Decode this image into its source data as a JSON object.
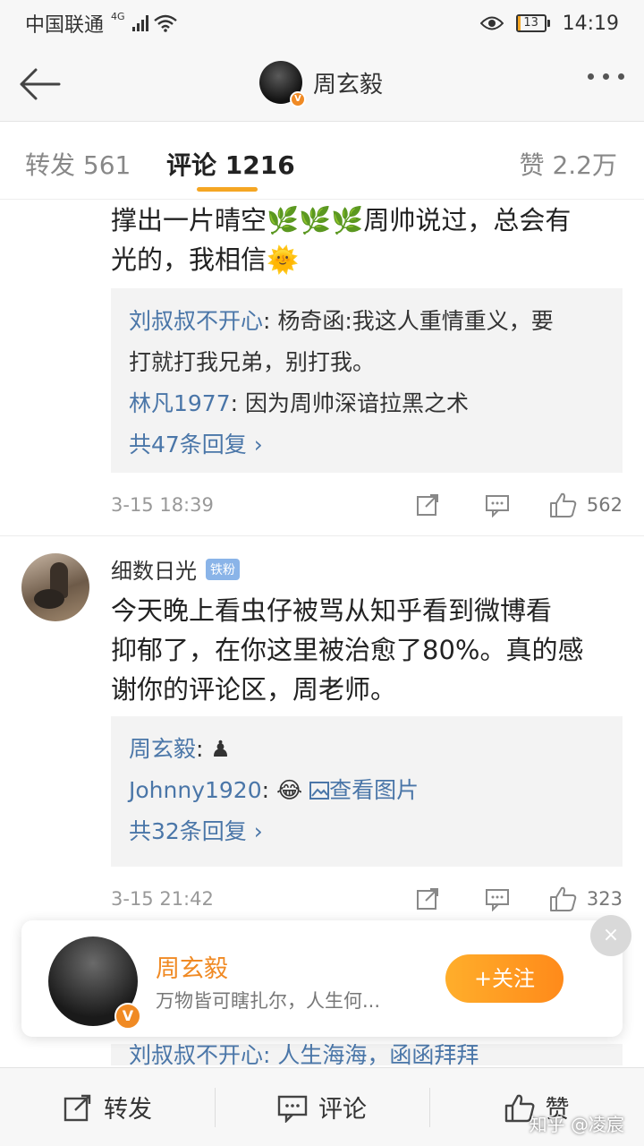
{
  "status_bar": {
    "carrier": "中国联通",
    "network": "4G",
    "battery": "13",
    "battery_level": 0.13,
    "time": "14:19"
  },
  "header": {
    "title": "周玄毅",
    "verified_badge": "V"
  },
  "tabs": {
    "repost": "转发 561",
    "comment": "评论 1216",
    "like": "赞 2.2万"
  },
  "comment1": {
    "text_line1": "撑出一片晴空🌿🌿🌿周帅说过，总会有",
    "text_line2": "光的，我相信🌞",
    "replies": [
      {
        "author": "刘叔叔不开心",
        "text": ": 杨奇函:我这人重情重义，要"
      },
      {
        "author": "",
        "text": "打就打我兄弟，别打我。"
      },
      {
        "author": "林凡1977",
        "text": ": 因为周帅深谙拉黑之术"
      }
    ],
    "reply_count": "共47条回复 ›",
    "time": "3-15 18:39",
    "likes": "562"
  },
  "comment2": {
    "username": "细数日光",
    "badge": "铁粉",
    "text_line1": "今天晚上看虫仔被骂从知乎看到微博看",
    "text_line2": "抑郁了，在你这里被治愈了80%。真的感",
    "text_line3": "谢你的评论区，周老师。",
    "replies": [
      {
        "author": "周玄毅",
        "text": ": ♟"
      },
      {
        "author": "Johnny1920",
        "text": ": 😂 "
      }
    ],
    "view_image": "查看图片",
    "reply_count": "共32条回复 ›",
    "time": "3-15 21:42",
    "likes": "323"
  },
  "follow_card": {
    "name": "周玄毅",
    "description": "万物皆可瞎扎尔，人生何...",
    "follow_button": "+关注",
    "close": "×",
    "verified_badge": "V"
  },
  "peek_reply": "刘叔叔不开心: 人生海海，函函拜拜",
  "bottom_bar": {
    "repost": "转发",
    "comment": "评论",
    "like": "赞"
  },
  "watermark": "知乎 @凌宸",
  "colors": {
    "accent": "#f5a623",
    "link": "#4a76a8",
    "follow_gradient_start": "#ffae2b",
    "follow_gradient_end": "#ff8a1a"
  },
  "icons": [
    "back-arrow-icon",
    "more-dots-icon",
    "share-icon",
    "comment-icon",
    "thumbs-up-icon",
    "image-icon",
    "chevron-right-icon",
    "close-icon",
    "eye-icon",
    "wifi-icon",
    "signal-icon",
    "battery-icon"
  ]
}
